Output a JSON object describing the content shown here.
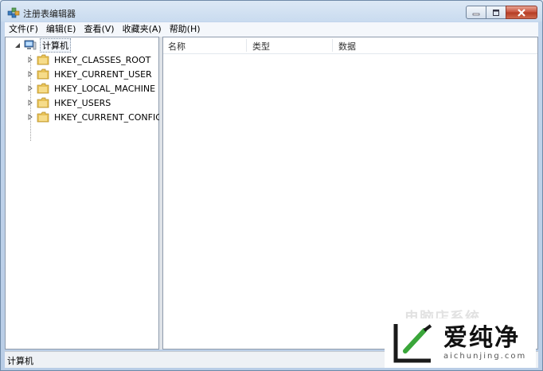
{
  "window": {
    "title": "注册表编辑器"
  },
  "menu": [
    "文件(F)",
    "编辑(E)",
    "查看(V)",
    "收藏夹(A)",
    "帮助(H)"
  ],
  "tree": {
    "root": {
      "label": "计算机",
      "expanded": true
    },
    "keys": [
      {
        "label": "HKEY_CLASSES_ROOT"
      },
      {
        "label": "HKEY_CURRENT_USER"
      },
      {
        "label": "HKEY_LOCAL_MACHINE"
      },
      {
        "label": "HKEY_USERS"
      },
      {
        "label": "HKEY_CURRENT_CONFIG"
      }
    ]
  },
  "list": {
    "columns": [
      "名称",
      "类型",
      "数据"
    ],
    "rows": []
  },
  "status": {
    "text": "计算机"
  },
  "watermark": {
    "faint_text": "电脑店系统",
    "brand_name": "爱纯净",
    "brand_url": "aichunjing.com"
  },
  "colors": {
    "folder": "#e8c35a",
    "close_button": "#c7503a",
    "window_frame": "#c2d5ec"
  }
}
